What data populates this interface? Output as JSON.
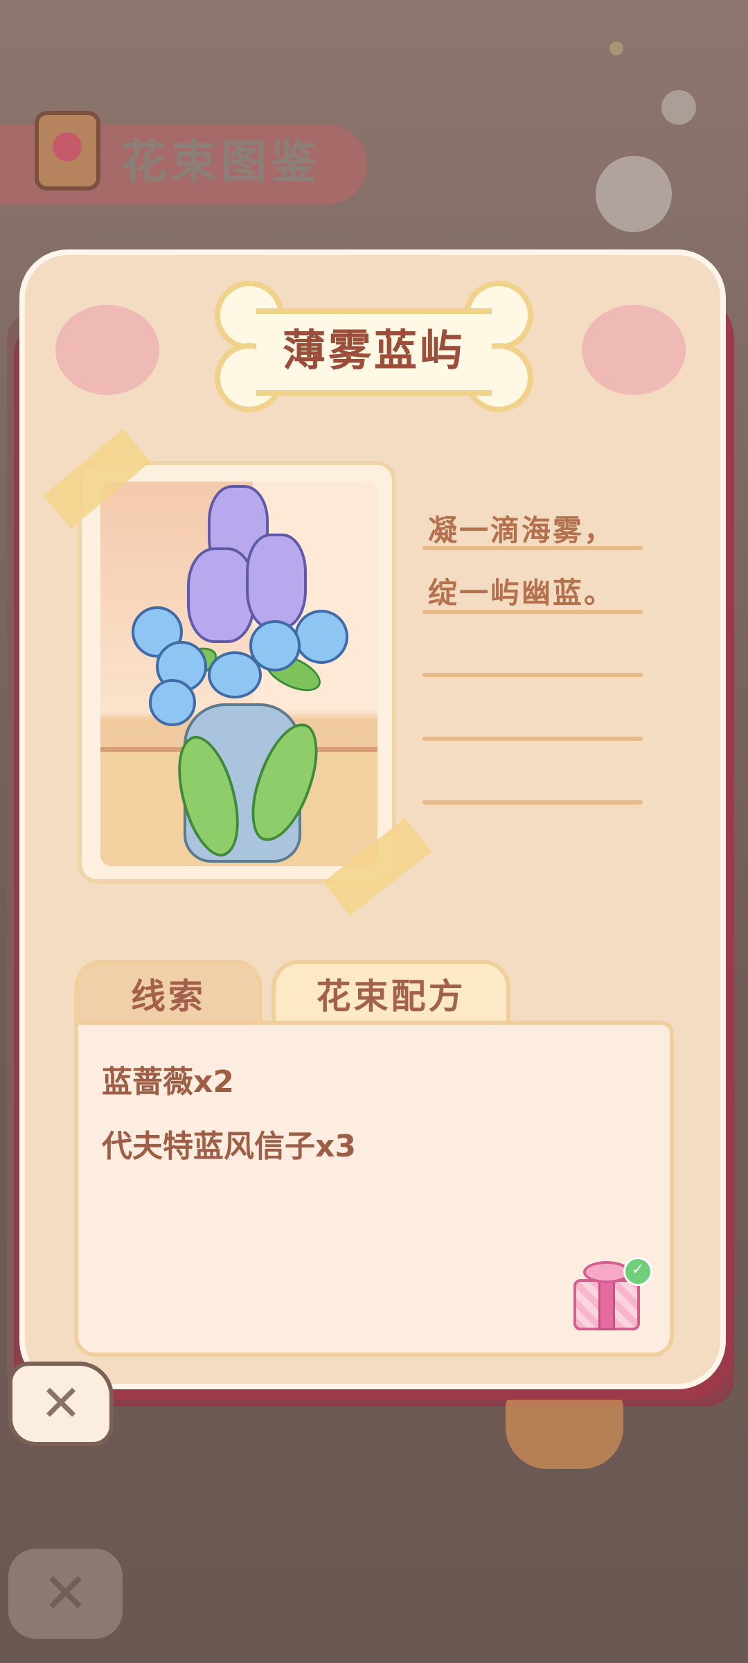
{
  "header": {
    "title": "花束图鉴",
    "book_icon": "flower-book-icon"
  },
  "bouquet": {
    "name": "薄雾蓝屿",
    "poem_lines": [
      "凝一滴海雾，",
      "绽一屿幽蓝。"
    ],
    "image_description_icon": "blue-hyacinth-vase-icon"
  },
  "tabs": [
    {
      "label": "线索",
      "active": false
    },
    {
      "label": "花束配方",
      "active": true
    }
  ],
  "recipe": {
    "items": [
      "蓝蔷薇x2",
      "代夫特蓝风信子x3"
    ],
    "reward_icon": "gift-box-icon",
    "reward_claimed": true
  },
  "close_button": {
    "label": "✕",
    "icon": "close-icon"
  },
  "colors": {
    "card": "#f3dcc2",
    "title_text": "#9b4e3a",
    "tab_active": "#fde9c6",
    "tab_inactive": "#f0d0a8",
    "accent": "#9c3a4a"
  }
}
